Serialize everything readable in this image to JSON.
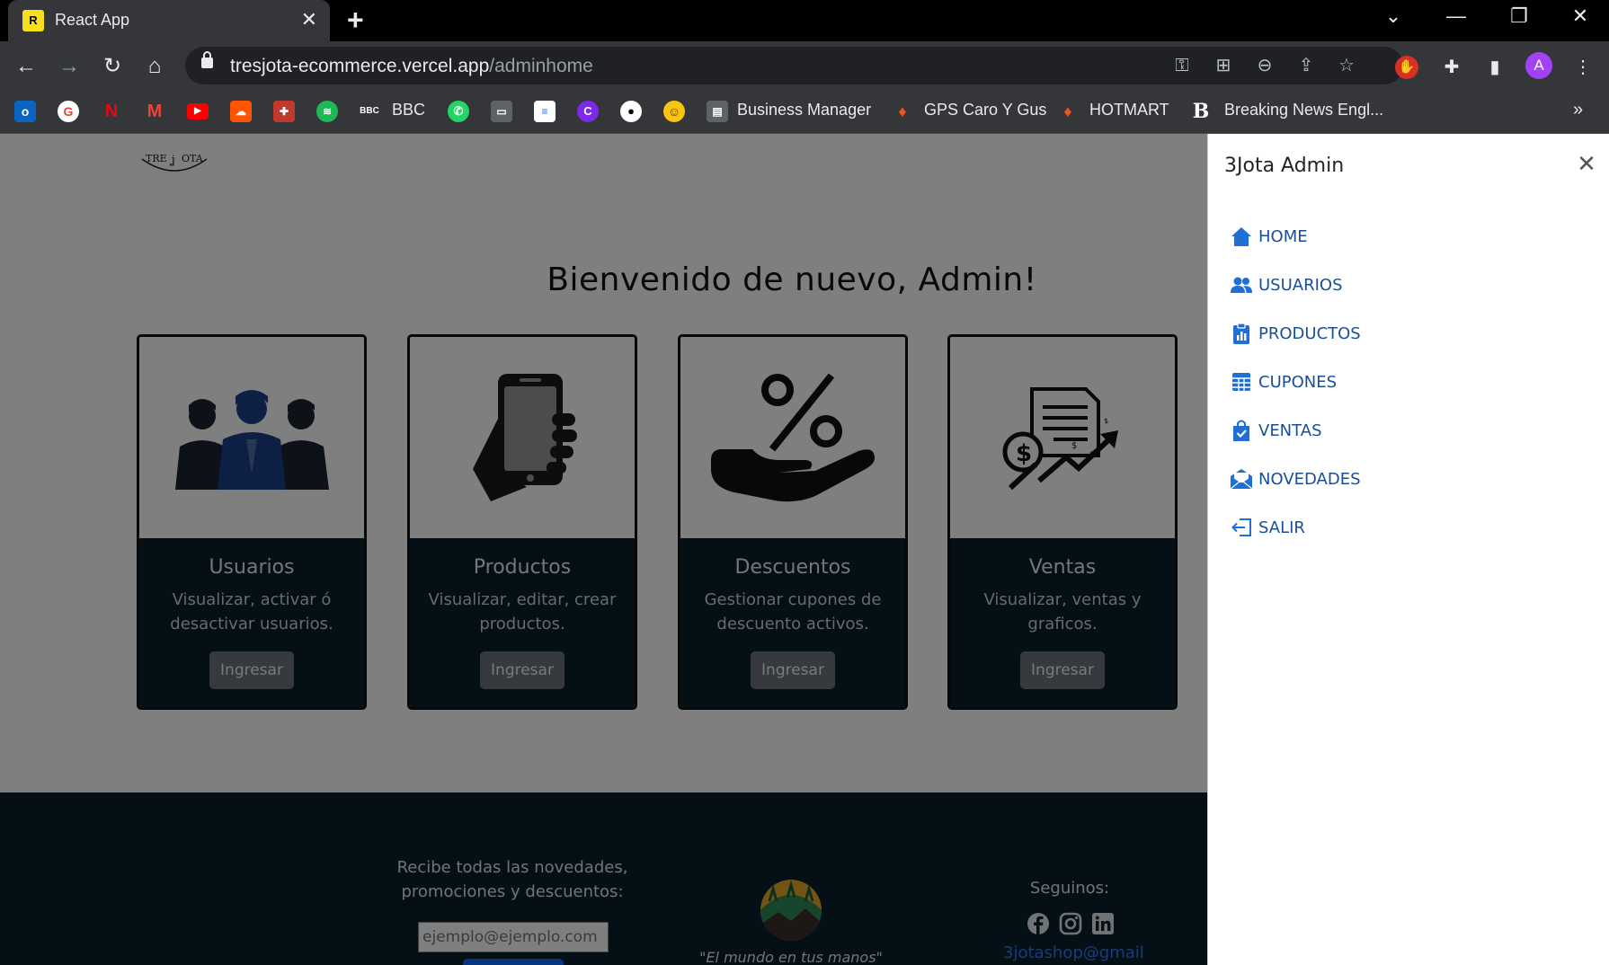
{
  "browser": {
    "tab_title": "React App",
    "url_host": "tresjota-ecommerce.vercel.app",
    "url_path": "/adminhome",
    "profile_initial": "A",
    "bookmarks": [
      {
        "icon": "outlook-icon",
        "label": ""
      },
      {
        "icon": "google-icon",
        "label": ""
      },
      {
        "icon": "netflix-icon",
        "label": ""
      },
      {
        "icon": "gmail-icon",
        "label": ""
      },
      {
        "icon": "youtube-icon",
        "label": ""
      },
      {
        "icon": "soundcloud-icon",
        "label": ""
      },
      {
        "icon": "crest-icon",
        "label": ""
      },
      {
        "icon": "spotify-icon",
        "label": ""
      },
      {
        "icon": "bbc-icon",
        "label": "BBC"
      },
      {
        "icon": "whatsapp-icon",
        "label": ""
      },
      {
        "icon": "book-icon",
        "label": ""
      },
      {
        "icon": "stack-icon",
        "label": ""
      },
      {
        "icon": "canva-icon",
        "label": ""
      },
      {
        "icon": "panda-icon",
        "label": ""
      },
      {
        "icon": "emoji-icon",
        "label": ""
      },
      {
        "icon": "business-icon",
        "label": "Business Manager"
      },
      {
        "icon": "flame-icon",
        "label": "GPS Caro Y Gus"
      },
      {
        "icon": "flame-icon",
        "label": "HOTMART"
      },
      {
        "icon": "b-icon",
        "label": "Breaking News Engl..."
      }
    ]
  },
  "page": {
    "welcome": "Bienvenido de nuevo, Admin!",
    "cards": [
      {
        "title": "Usuarios",
        "text": "Visualizar, activar ó desactivar usuarios.",
        "button": "Ingresar",
        "icon": "users-icon"
      },
      {
        "title": "Productos",
        "text": "Visualizar, editar, crear productos.",
        "button": "Ingresar",
        "icon": "phone-icon"
      },
      {
        "title": "Descuentos",
        "text": "Gestionar cupones de descuento activos.",
        "button": "Ingresar",
        "icon": "percent-hand-icon"
      },
      {
        "title": "Ventas",
        "text": "Visualizar, ventas y graficos.",
        "button": "Ingresar",
        "icon": "sales-chart-icon"
      }
    ],
    "footer": {
      "newsletter_text": "Recibe todas las novedades, promociones y descuentos:",
      "email_placeholder": "ejemplo@ejemplo.com",
      "slogan": "\"El mundo en tus manos\"",
      "follow": "Seguinos:",
      "email": "3jotashop@gmail"
    }
  },
  "offcanvas": {
    "title": "3Jota Admin",
    "items": [
      {
        "label": "HOME",
        "icon": "home-icon"
      },
      {
        "label": "USUARIOS",
        "icon": "users-icon"
      },
      {
        "label": "PRODUCTOS",
        "icon": "clipboard-chart-icon"
      },
      {
        "label": "CUPONES",
        "icon": "table-icon"
      },
      {
        "label": "VENTAS",
        "icon": "shopping-bag-icon"
      },
      {
        "label": "NOVEDADES",
        "icon": "mail-open-icon"
      },
      {
        "label": "SALIR",
        "icon": "logout-icon"
      }
    ]
  },
  "colors": {
    "accent": "#1a4f97",
    "card_body": "#0b1f2d",
    "button": "#6c757d"
  }
}
